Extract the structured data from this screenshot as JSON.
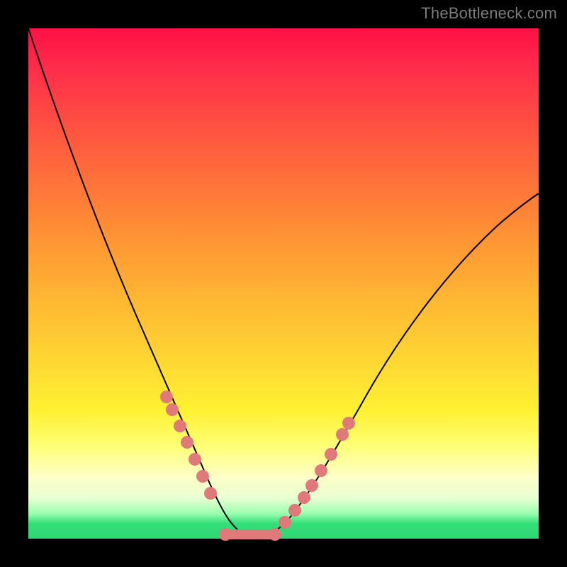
{
  "watermark": "TheBottleneck.com",
  "chart_data": {
    "type": "line",
    "title": "",
    "xlabel": "",
    "ylabel": "",
    "xlim": [
      0,
      100
    ],
    "ylim": [
      0,
      100
    ],
    "grid": false,
    "legend": false,
    "series": [
      {
        "name": "bottleneck-curve",
        "x": [
          0,
          5,
          10,
          15,
          20,
          25,
          30,
          33,
          36,
          38,
          40,
          42,
          45,
          50,
          55,
          60,
          65,
          70,
          75,
          80,
          85,
          90,
          95,
          100
        ],
        "y": [
          100,
          85,
          71,
          58,
          46,
          34,
          23,
          16,
          10,
          6,
          3,
          1,
          0,
          2,
          7,
          14,
          22,
          30,
          38,
          45,
          52,
          58,
          63,
          67
        ]
      }
    ],
    "markers": {
      "left": [
        {
          "x": 27,
          "y": 27
        },
        {
          "x": 28,
          "y": 25
        },
        {
          "x": 30,
          "y": 22
        },
        {
          "x": 31,
          "y": 19
        },
        {
          "x": 33,
          "y": 15
        },
        {
          "x": 34,
          "y": 13
        },
        {
          "x": 36,
          "y": 10
        }
      ],
      "right": [
        {
          "x": 50,
          "y": 3
        },
        {
          "x": 52,
          "y": 5
        },
        {
          "x": 54,
          "y": 8
        },
        {
          "x": 55,
          "y": 10
        },
        {
          "x": 57,
          "y": 13
        },
        {
          "x": 59,
          "y": 16
        },
        {
          "x": 61,
          "y": 20
        },
        {
          "x": 63,
          "y": 24
        }
      ],
      "bottom_segment": {
        "x1": 38,
        "x2": 48,
        "y": 0
      }
    },
    "background_gradient": {
      "top": "#ff1147",
      "mid": "#ffd433",
      "bottom": "#2dd673"
    }
  }
}
